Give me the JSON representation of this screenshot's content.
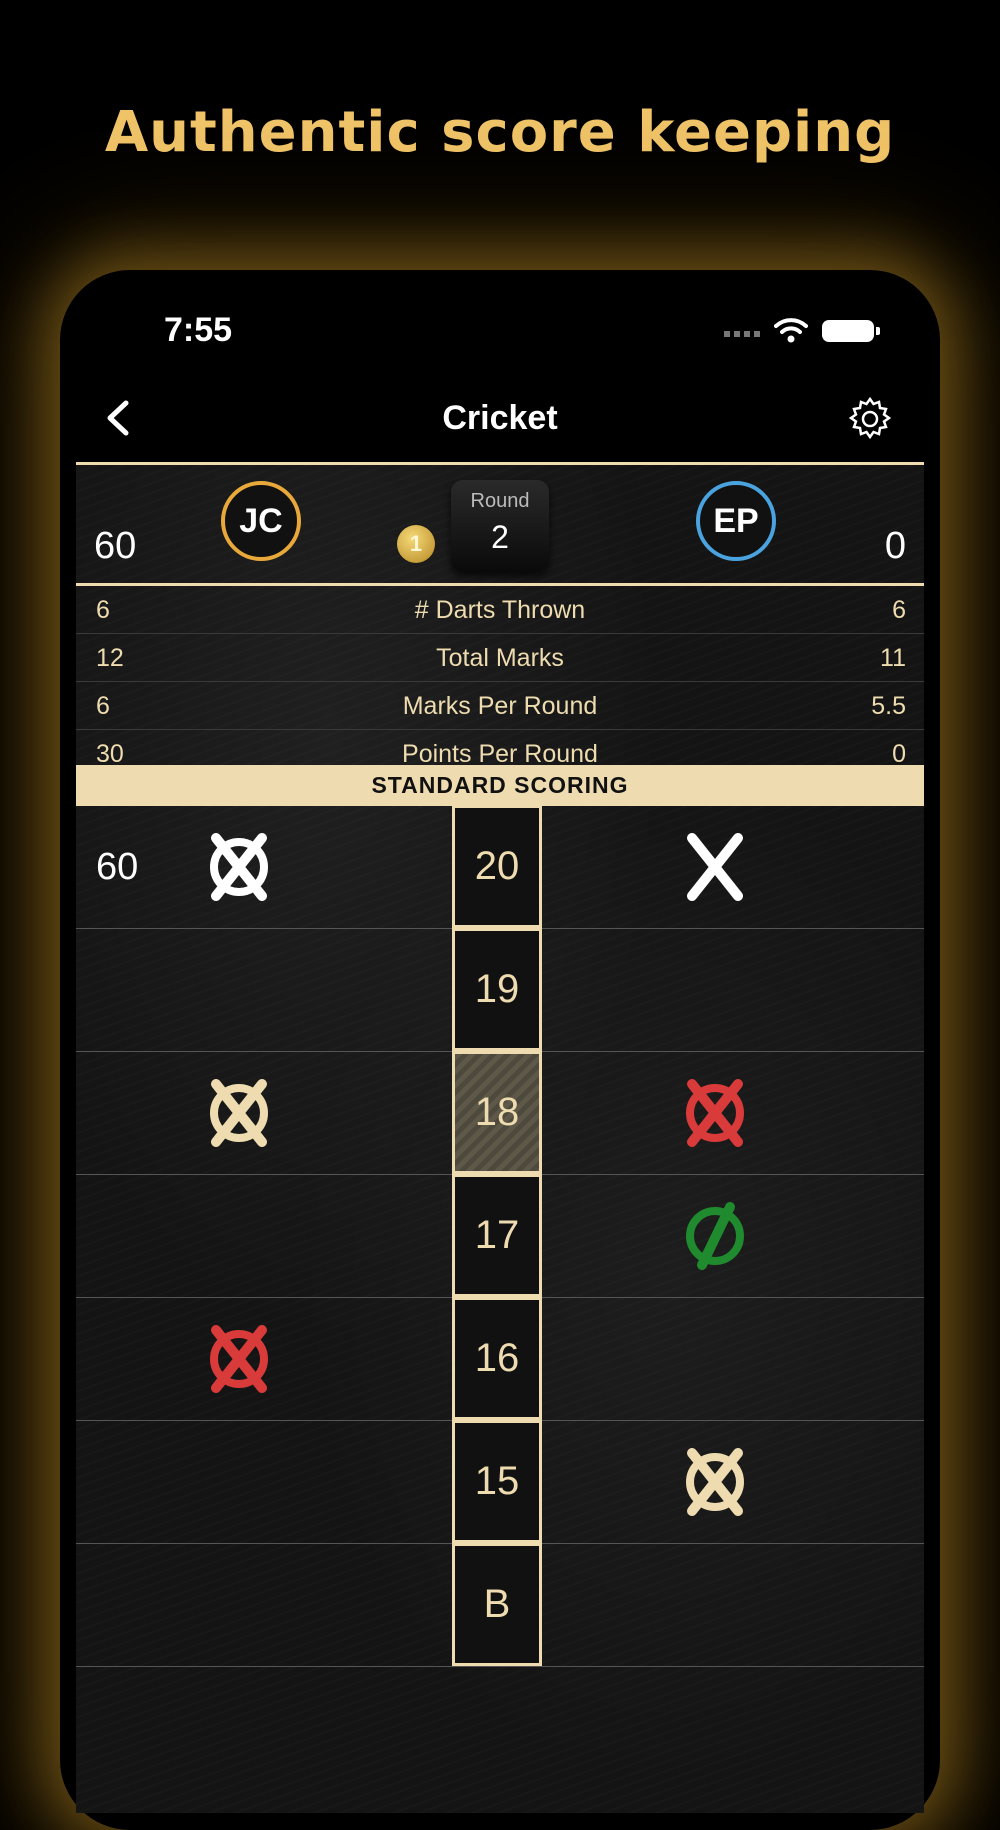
{
  "headline": "Authentic score keeping",
  "status_bar": {
    "time": "7:55"
  },
  "nav": {
    "title": "Cricket"
  },
  "players": {
    "left": {
      "initials": "JC",
      "score": "60",
      "ring_color": "#e8a93a"
    },
    "right": {
      "initials": "EP",
      "score": "0",
      "ring_color": "#4aa3df"
    },
    "turn_badge": "1",
    "round_label": "Round",
    "round_value": "2"
  },
  "stats": [
    {
      "left": "6",
      "label": "# Darts Thrown",
      "right": "6"
    },
    {
      "left": "12",
      "label": "Total Marks",
      "right": "11"
    },
    {
      "left": "6",
      "label": "Marks Per Round",
      "right": "5.5"
    },
    {
      "left": "30",
      "label": "Points Per Round",
      "right": "0"
    }
  ],
  "scoring_banner": "STANDARD SCORING",
  "targets": [
    {
      "label": "20",
      "left_score": "60",
      "left_mark": "closed",
      "left_color": "#ffffff",
      "right_mark": "x",
      "right_color": "#ffffff"
    },
    {
      "label": "19"
    },
    {
      "label": "18",
      "highlight": true,
      "left_mark": "closed",
      "left_color": "#eedcb0",
      "right_mark": "closed",
      "right_color": "#d93a3a"
    },
    {
      "label": "17",
      "right_mark": "slash-circle",
      "right_color": "#1f8a2e"
    },
    {
      "label": "16",
      "left_mark": "closed",
      "left_color": "#d93a3a"
    },
    {
      "label": "15",
      "right_mark": "closed",
      "right_color": "#eedcb0"
    },
    {
      "label": "B"
    }
  ],
  "colors": {
    "accent": "#f0c468",
    "chalk_cream": "#eedcb0"
  }
}
